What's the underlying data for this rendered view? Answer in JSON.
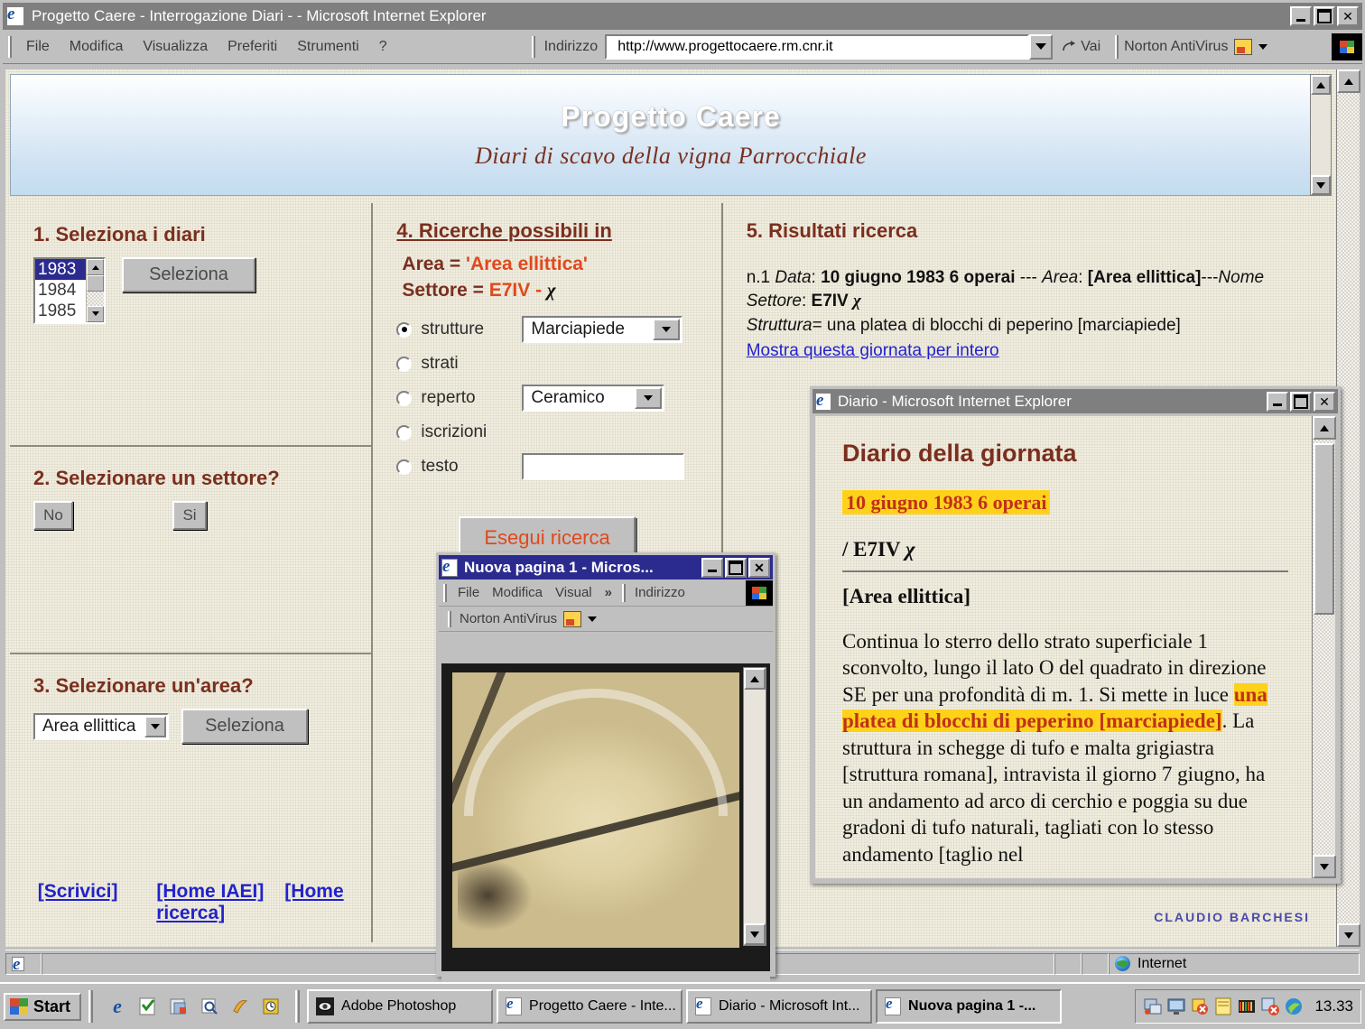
{
  "browser": {
    "title": "Progetto Caere - Interrogazione Diari - - Microsoft Internet Explorer",
    "menu": [
      "File",
      "Modifica",
      "Visualizza",
      "Preferiti",
      "Strumenti",
      "?"
    ],
    "address_label": "Indirizzo",
    "address_value": "http://www.progettocaere.rm.cnr.it",
    "go_label": "Vai",
    "norton_label": "Norton AntiVirus",
    "minimize": "_",
    "maximize": "□",
    "close": "✕",
    "status_zone": "Internet"
  },
  "banner": {
    "title": "Progetto Caere",
    "subtitle": "Diari di scavo della vigna Parrocchiale"
  },
  "step1": {
    "heading": "1. Seleziona i diari",
    "options": [
      "1983",
      "1984",
      "1985"
    ],
    "selected": "1983",
    "button": "Seleziona"
  },
  "step2": {
    "heading": "2. Selezionare un settore?",
    "no_button": "No",
    "yes_button": "Si"
  },
  "step3": {
    "heading": "3. Selezionare un'area?",
    "select_value": "Area ellittica",
    "button": "Seleziona"
  },
  "step4": {
    "heading": "4. Ricerche possibili in",
    "area_label": "Area = ",
    "area_value": "'Area ellittica'",
    "settore_label": "Settore = ",
    "settore_value": "E7IV - ",
    "settore_greek": "χ",
    "radios": [
      {
        "label": "strutture",
        "checked": true,
        "control": "select",
        "value": "Marciapiede"
      },
      {
        "label": " strati",
        "checked": false,
        "control": "none",
        "value": ""
      },
      {
        "label": "reperto",
        "checked": false,
        "control": "select",
        "value": "Ceramico"
      },
      {
        "label": "iscrizioni",
        "checked": false,
        "control": "none",
        "value": ""
      },
      {
        "label": "testo",
        "checked": false,
        "control": "text",
        "value": ""
      }
    ],
    "submit": "Esegui ricerca"
  },
  "step5": {
    "heading": "5. Risultati ricerca",
    "result_index": "n.1 ",
    "data_label": "Data",
    "data_value": "10 giugno 1983 6 operai",
    "sep1": " --- ",
    "area_label": "Area",
    "area_value": "[Area ellittica]",
    "sep2": "---",
    "settore_label": "Nome Settore",
    "settore_value": "E7IV ",
    "settore_greek": "χ",
    "struttura_label": "Struttura",
    "struttura_value": "= una platea di blocchi di peperino [marciapiede]",
    "link": "Mostra questa giornata per intero"
  },
  "footer": {
    "links": [
      "[Scrivici]",
      "[Home IAEI]",
      "[Home ricerca]"
    ],
    "credit": "CLAUDIO BARCHESI"
  },
  "diario_window": {
    "title": "Diario - Microsoft Internet Explorer",
    "minimize": "_",
    "maximize": "□",
    "close": "✕",
    "heading": "Diario della giornata",
    "date_highlight": "10 giugno 1983 6 operai",
    "sector": "/ E7IV ",
    "sector_greek": "χ",
    "area": "[Area ellittica]",
    "body_before": "Continua lo sterro dello strato superficiale 1 sconvolto, lungo il lato O del quadrato in direzione SE per una profondità di m. 1. Si mette in luce ",
    "body_highlight": "una platea di blocchi di peperino [marciapiede]",
    "body_after": ". La struttura in schegge di tufo e malta grigiastra [struttura romana], intravista il giorno 7 giugno, ha un andamento ad arco di cerchio e poggia su due gradoni di tufo naturali, tagliati con lo stesso andamento [taglio nel"
  },
  "nuova_window": {
    "title": "Nuova pagina 1 - Micros...",
    "minimize": "_",
    "maximize": "□",
    "close": "✕",
    "menu": [
      "File",
      "Modifica",
      "Visual"
    ],
    "menu_overflow": "»",
    "address_label": "Indirizzo",
    "norton_label": "Norton AntiVirus",
    "photo_alt": "archaeological-excavation-photo"
  },
  "taskbar": {
    "start": "Start",
    "quicklaunch": [
      "ie-icon",
      "outlook-icon",
      "show-desktop-icon",
      "search-icon",
      "media-icon",
      "clock-icon"
    ],
    "tasks": [
      {
        "label": "Adobe Photoshop",
        "icon": "photoshop-icon",
        "active": false
      },
      {
        "label": "Progetto Caere - Inte...",
        "icon": "ie-icon",
        "active": false
      },
      {
        "label": "Diario - Microsoft Int...",
        "icon": "ie-icon",
        "active": false
      },
      {
        "label": "Nuova pagina 1 -...",
        "icon": "ie-icon",
        "active": true
      }
    ],
    "clock": "13.33"
  },
  "colors": {
    "heading": "#7a2f1e",
    "accent_orange": "#e0491c",
    "link": "#2222cc",
    "highlight_bg": "#ffd21a",
    "highlight_fg": "#c0301a",
    "titlebar_active": "#2b2b8f",
    "titlebar_inactive": "#7f7f7f",
    "paper": "#f1eee1"
  }
}
